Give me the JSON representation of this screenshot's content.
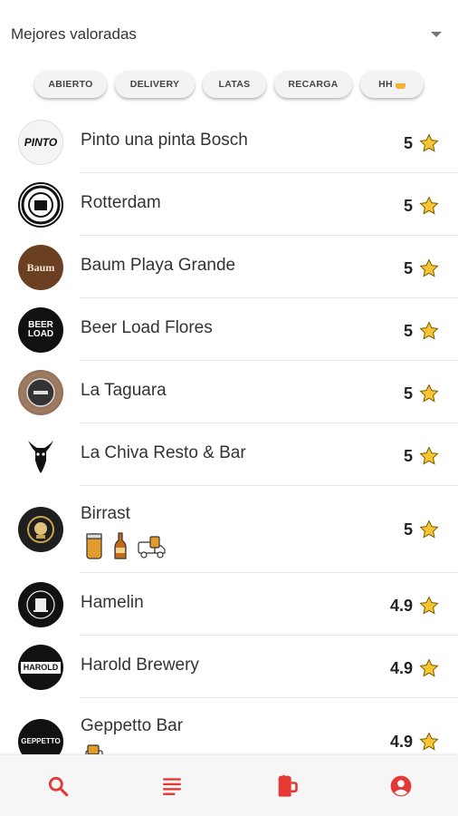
{
  "sort": {
    "label": "Mejores valoradas"
  },
  "filters": [
    {
      "label": "ABIERTO"
    },
    {
      "label": "DELIVERY"
    },
    {
      "label": "LATAS"
    },
    {
      "label": "RECARGA"
    },
    {
      "label": "HH"
    }
  ],
  "bars": [
    {
      "name": "Pinto una pinta Bosch",
      "rating": "5",
      "logo_text": "PINTO"
    },
    {
      "name": "Rotterdam",
      "rating": "5",
      "logo_text": ""
    },
    {
      "name": "Baum Playa Grande",
      "rating": "5",
      "logo_text": "Baum"
    },
    {
      "name": "Beer Load Flores",
      "rating": "5",
      "logo_text": "BEER LOAD"
    },
    {
      "name": "La Taguara",
      "rating": "5",
      "logo_text": ""
    },
    {
      "name": "La Chiva Resto & Bar",
      "rating": "5",
      "logo_text": ""
    },
    {
      "name": "Birrast",
      "rating": "5",
      "logo_text": ""
    },
    {
      "name": "Hamelin",
      "rating": "4.9",
      "logo_text": ""
    },
    {
      "name": "Harold Brewery",
      "rating": "4.9",
      "logo_text": "HAROLD"
    },
    {
      "name": "Geppetto Bar",
      "rating": "4.9",
      "logo_text": "GEPPETTO"
    }
  ],
  "icons": {
    "star": "star-icon",
    "nav": [
      "search-icon",
      "list-icon",
      "beer-mug-icon",
      "account-icon"
    ]
  },
  "colors": {
    "accent": "#e53935",
    "star": "#f7c531"
  }
}
